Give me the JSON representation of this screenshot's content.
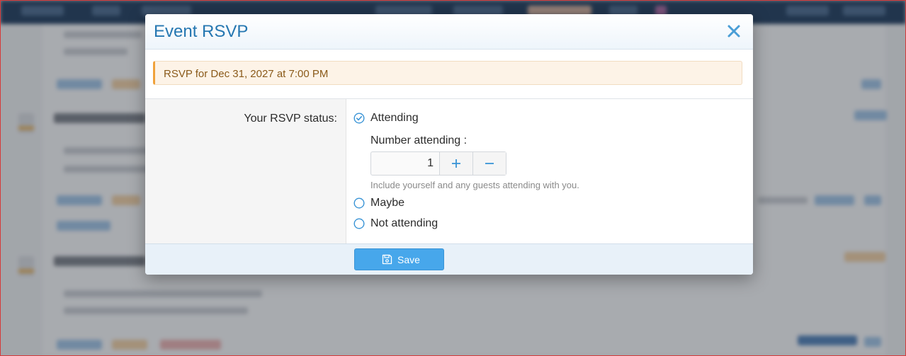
{
  "modal": {
    "title": "Event RSVP",
    "close_icon": "close-icon",
    "notice": "RSVP for Dec 31, 2027 at 7:00 PM",
    "rsvp_label": "Your RSVP status:",
    "options": [
      {
        "label": "Attending",
        "selected": true
      },
      {
        "label": "Maybe",
        "selected": false
      },
      {
        "label": "Not attending",
        "selected": false
      }
    ],
    "number_attending": {
      "label": "Number attending :",
      "value": "1",
      "hint": "Include yourself and any guests attending with you."
    },
    "save_label": "Save",
    "save_icon": "floppy-disk-icon"
  },
  "colors": {
    "accent": "#47a7eb",
    "title": "#2577b1",
    "notice_border": "#f0a23b",
    "notice_bg": "#fdf3e7"
  }
}
